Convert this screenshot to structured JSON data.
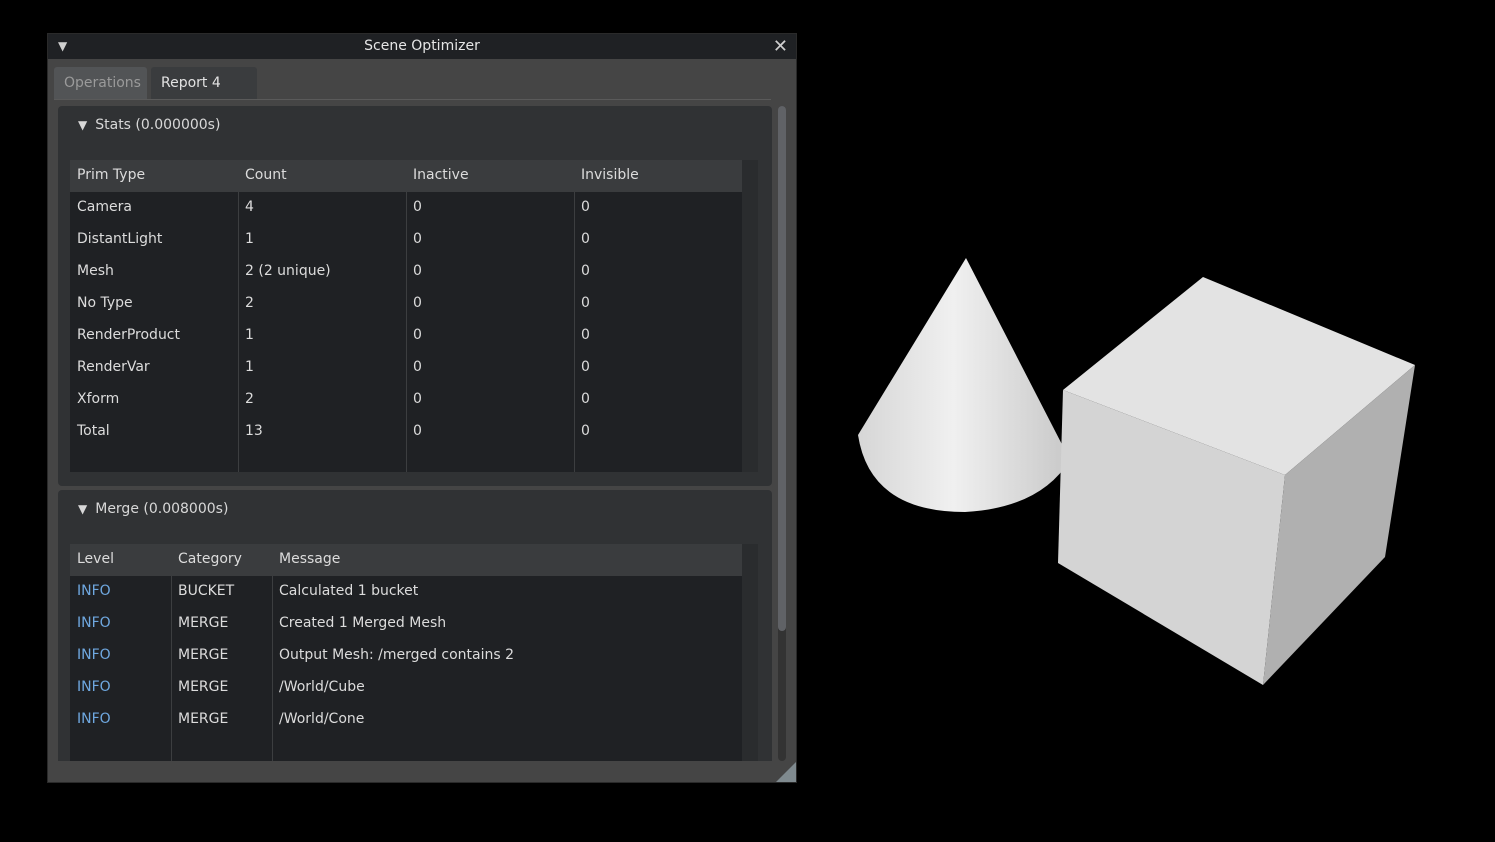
{
  "window": {
    "title": "Scene Optimizer",
    "collapse_glyph": "▼",
    "close_glyph": "✕"
  },
  "tabs": [
    {
      "label": "Operations"
    },
    {
      "label": "Report 4"
    }
  ],
  "stats": {
    "header": "Stats (0.000000s)",
    "columns": [
      "Prim Type",
      "Count",
      "Inactive",
      "Invisible"
    ],
    "rows": [
      [
        "Camera",
        "4",
        "0",
        "0"
      ],
      [
        "DistantLight",
        "1",
        "0",
        "0"
      ],
      [
        "Mesh",
        "2 (2 unique)",
        "0",
        "0"
      ],
      [
        "No Type",
        "2",
        "0",
        "0"
      ],
      [
        "RenderProduct",
        "1",
        "0",
        "0"
      ],
      [
        "RenderVar",
        "1",
        "0",
        "0"
      ],
      [
        "Xform",
        "2",
        "0",
        "0"
      ],
      [
        "Total",
        "13",
        "0",
        "0"
      ]
    ]
  },
  "merge": {
    "header": "Merge (0.008000s)",
    "columns": [
      "Level",
      "Category",
      "Message"
    ],
    "rows": [
      [
        "INFO",
        "BUCKET",
        "Calculated 1 bucket"
      ],
      [
        "INFO",
        "MERGE",
        "Created 1 Merged Mesh"
      ],
      [
        "INFO",
        "MERGE",
        "Output Mesh: /merged contains 2"
      ],
      [
        "INFO",
        "MERGE",
        "/World/Cube"
      ],
      [
        "INFO",
        "MERGE",
        "/World/Cone"
      ]
    ]
  },
  "colors": {
    "info_level": "#6fa8e0",
    "window_bg": "#454545",
    "panel_bg": "#303234",
    "table_bg": "#1f2124"
  },
  "icons": {
    "collapse": "triangle-down-icon",
    "close": "close-icon",
    "resize": "resize-grip-icon"
  }
}
